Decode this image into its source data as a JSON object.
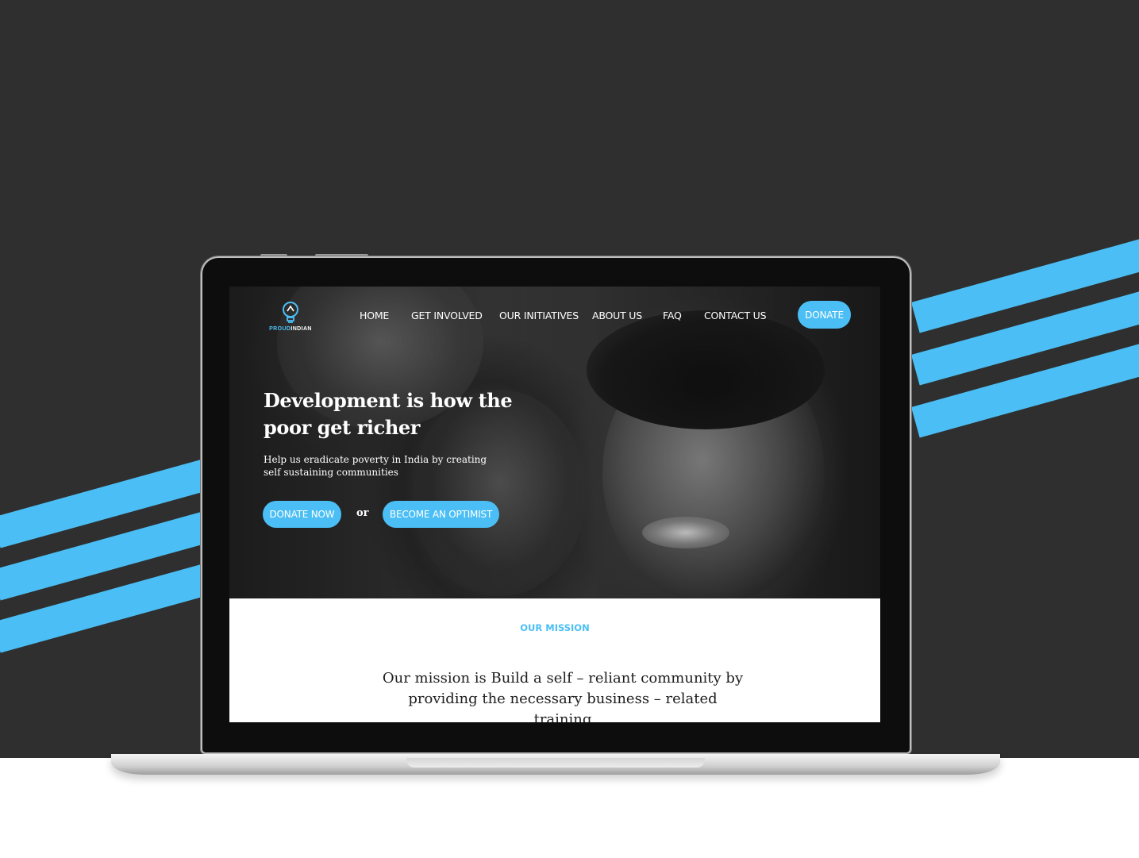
{
  "colors": {
    "accent": "#4bbff5",
    "backdrop": "#2f2f2f"
  },
  "site": {
    "logo": {
      "name_part1": "PROUD",
      "name_part2": "INDIAN",
      "icon": "lightbulb-icon"
    },
    "nav": {
      "items": [
        {
          "label": "HOME"
        },
        {
          "label": "GET INVOLVED"
        },
        {
          "label": "OUR INITIATIVES"
        },
        {
          "label": "ABOUT US"
        },
        {
          "label": "FAQ"
        },
        {
          "label": "CONTACT US"
        }
      ],
      "donate_label": "DONATE"
    },
    "hero": {
      "title": "Development is how the poor get richer",
      "subtitle": "Help us  eradicate poverty in India by creating self sustaining communities",
      "donate_now_label": "DONATE NOW",
      "or_label": "or",
      "optimist_label": "BECOME AN OPTIMIST"
    },
    "mission": {
      "label": "OUR MISSION",
      "text": "Our mission is Build a self – reliant community by providing the necessary business – related training"
    }
  }
}
